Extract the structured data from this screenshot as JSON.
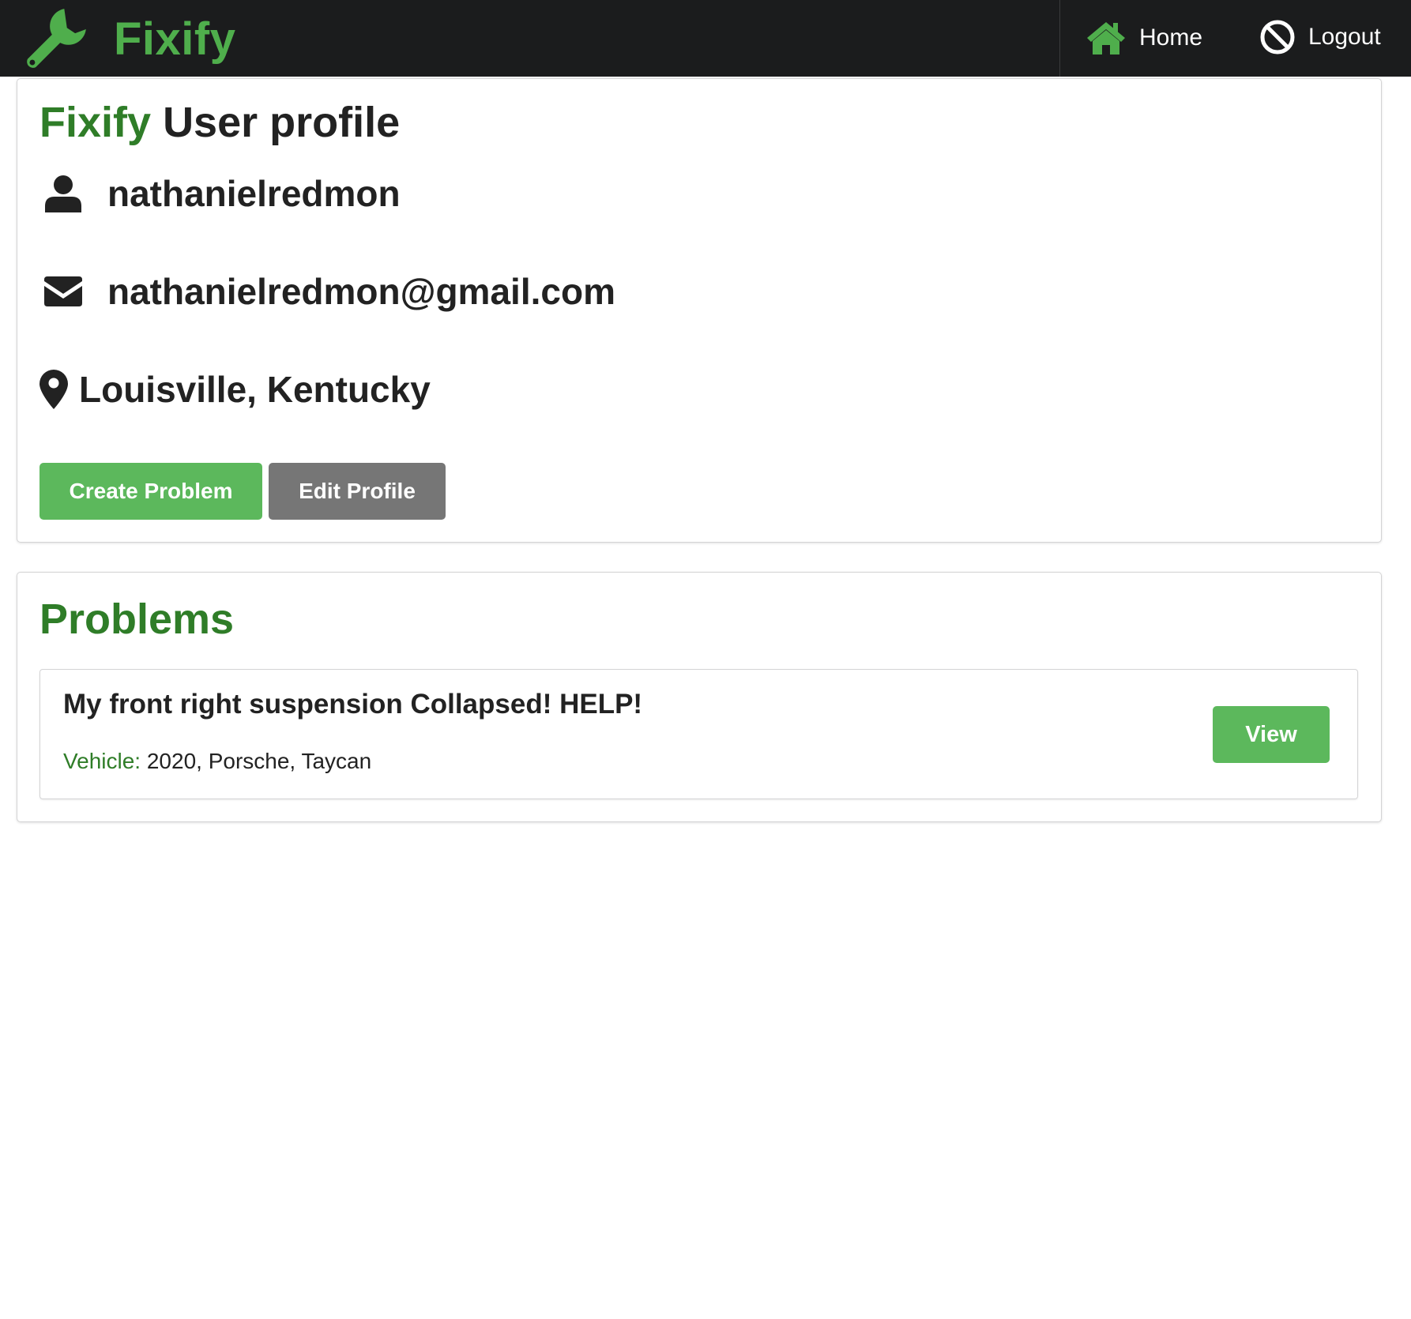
{
  "navbar": {
    "brand": "Fixify",
    "home_label": "Home",
    "logout_label": "Logout",
    "icons": [
      "wrench-icon",
      "home-icon",
      "ban-icon"
    ]
  },
  "profile": {
    "title_brand": "Fixify",
    "title_rest": "User profile",
    "username": "nathanielredmon",
    "email": "nathanielredmon@gmail.com",
    "location": "Louisville, Kentucky",
    "icons": [
      "user-icon",
      "envelope-icon",
      "map-marker-icon"
    ],
    "create_problem_label": "Create Problem",
    "edit_profile_label": "Edit Profile"
  },
  "problems": {
    "title": "Problems",
    "items": [
      {
        "title": "My front right suspension Collapsed! HELP!",
        "vehicle_label": "Vehicle:",
        "vehicle_value": "2020, Porsche, Taycan",
        "view_label": "View"
      }
    ]
  },
  "colors": {
    "navbar_bg": "#1b1c1d",
    "brand_green": "#4fae4c",
    "heading_green": "#2f7d28",
    "button_green": "#5cb85c",
    "button_grey": "#767676"
  }
}
